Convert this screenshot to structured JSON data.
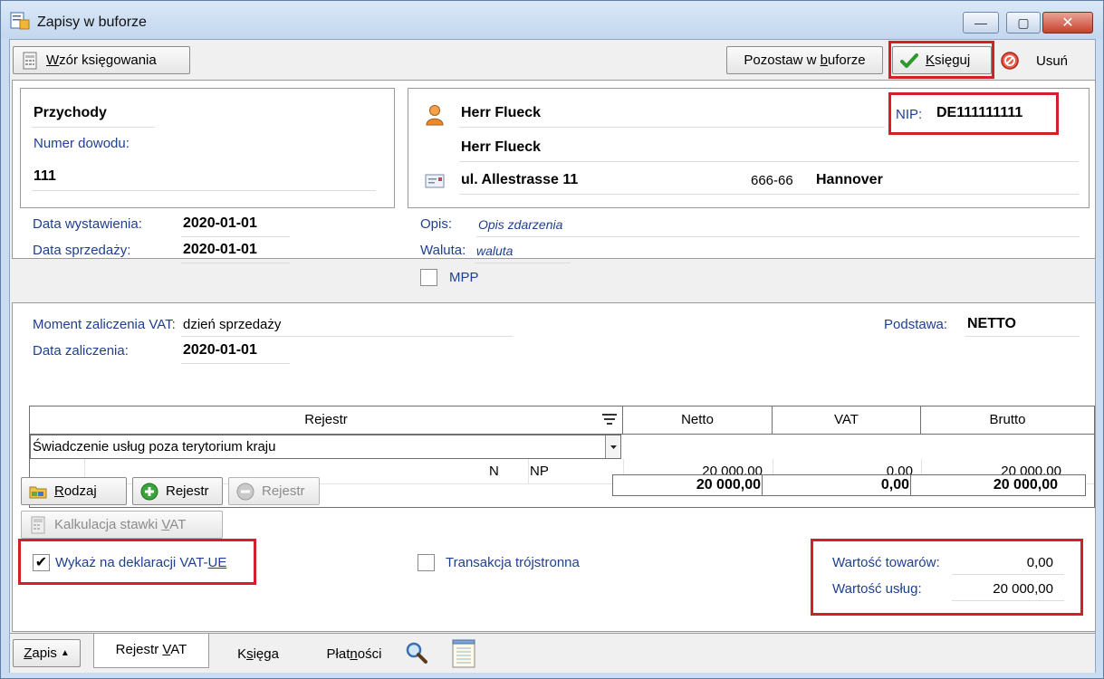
{
  "window": {
    "title": "Zapisy w buforze",
    "minimize_glyph": "—",
    "maximize_glyph": "▢",
    "close_glyph": "✕"
  },
  "toolbar": {
    "template_prefix": "W",
    "template_rest": "zór księgowania",
    "leave_prefix": "Pozostaw w ",
    "leave_under": "b",
    "leave_rest": "uforze",
    "post_under": "K",
    "post_rest": "sięguj",
    "delete_label": "Usuń"
  },
  "document": {
    "type": "Przychody",
    "number_label": "Numer dowodu:",
    "number": "111"
  },
  "contractor": {
    "name1": "Herr Flueck",
    "name2": "Herr Flueck",
    "nip_label": "NIP:",
    "nip": "DE111111111",
    "street": "ul. Allestrasse 11",
    "postal_code": "666-66",
    "city": "Hannover"
  },
  "dates": {
    "issue_label": "Data wystawienia:",
    "issue": "2020-01-01",
    "sale_label": "Data sprzedaży:",
    "sale": "2020-01-01"
  },
  "details": {
    "description_label": "Opis:",
    "description": "Opis zdarzenia",
    "currency_label": "Waluta:",
    "currency": "waluta",
    "mpp_label": "MPP",
    "mpp_checked": false
  },
  "vat": {
    "moment_label": "Moment zaliczenia VAT:",
    "moment": "dzień sprzedaży",
    "date_label": "Data zaliczenia:",
    "date": "2020-01-01",
    "basis_label": "Podstawa:",
    "basis": "NETTO"
  },
  "grid": {
    "headers": {
      "register": "Rejestr",
      "net": "Netto",
      "vat": "VAT",
      "gross": "Brutto"
    },
    "register_value": "Świadczenie usług poza terytorium kraju",
    "row": {
      "code1": "N",
      "code2": "NP",
      "net": "20 000,00",
      "vat": "0,00",
      "gross": "20 000,00"
    }
  },
  "totals": {
    "net": "20 000,00",
    "vat": "0,00",
    "gross": "20 000,00"
  },
  "buttons": {
    "kind_under": "R",
    "kind_rest": "odzaj",
    "add_register": "Rejestr",
    "remove_register": "Rejestr",
    "calc_prefix": "Kalkulacja stawki ",
    "calc_under": "V",
    "calc_rest": "AT"
  },
  "declaration": {
    "show_prefix": "Wykaż na deklaracji VAT-",
    "show_under": "UE",
    "show_checked": true,
    "triangular_label": "Transakcja trójstronna",
    "triangular_checked": false,
    "goods_label": "Wartość towarów:",
    "goods_value": "0,00",
    "services_label": "Wartość usług:",
    "services_value": "20 000,00"
  },
  "tabs": {
    "record_under": "Z",
    "record_rest": "apis",
    "vat_prefix": "Rejestr ",
    "vat_under": "V",
    "vat_rest": "AT",
    "ledger_prefix": "K",
    "ledger_under": "s",
    "ledger_rest": "ięga",
    "payments_prefix": "Płat",
    "payments_under": "n",
    "payments_rest": "ości"
  },
  "colors": {
    "accent_red": "#d21f2a",
    "label_blue": "#1f3f8f"
  }
}
